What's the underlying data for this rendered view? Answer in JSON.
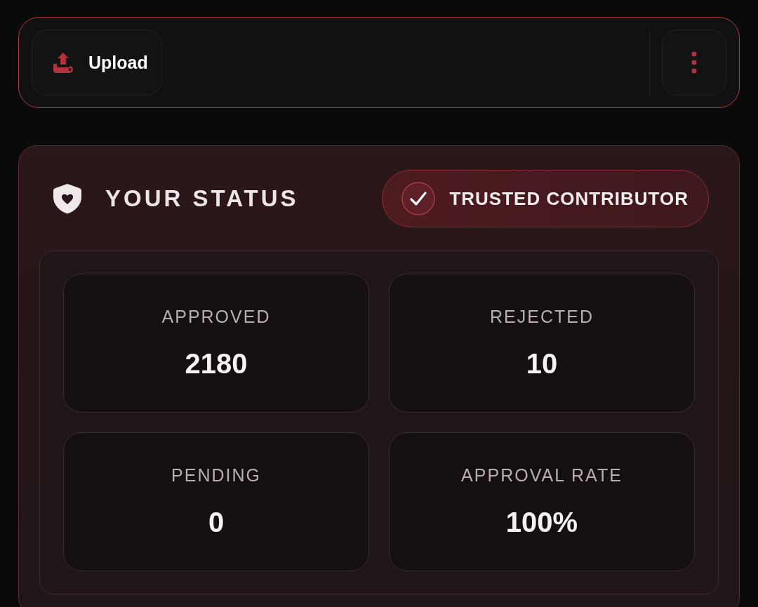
{
  "toolbar": {
    "upload_button": {
      "label": "Upload"
    }
  },
  "status": {
    "title": "YOUR STATUS",
    "badge": {
      "label": "TRUSTED CONTRIBUTOR"
    },
    "stats": [
      {
        "label": "APPROVED",
        "value": "2180"
      },
      {
        "label": "REJECTED",
        "value": "10"
      },
      {
        "label": "PENDING",
        "value": "0"
      },
      {
        "label": "APPROVAL RATE",
        "value": "100%"
      }
    ]
  }
}
